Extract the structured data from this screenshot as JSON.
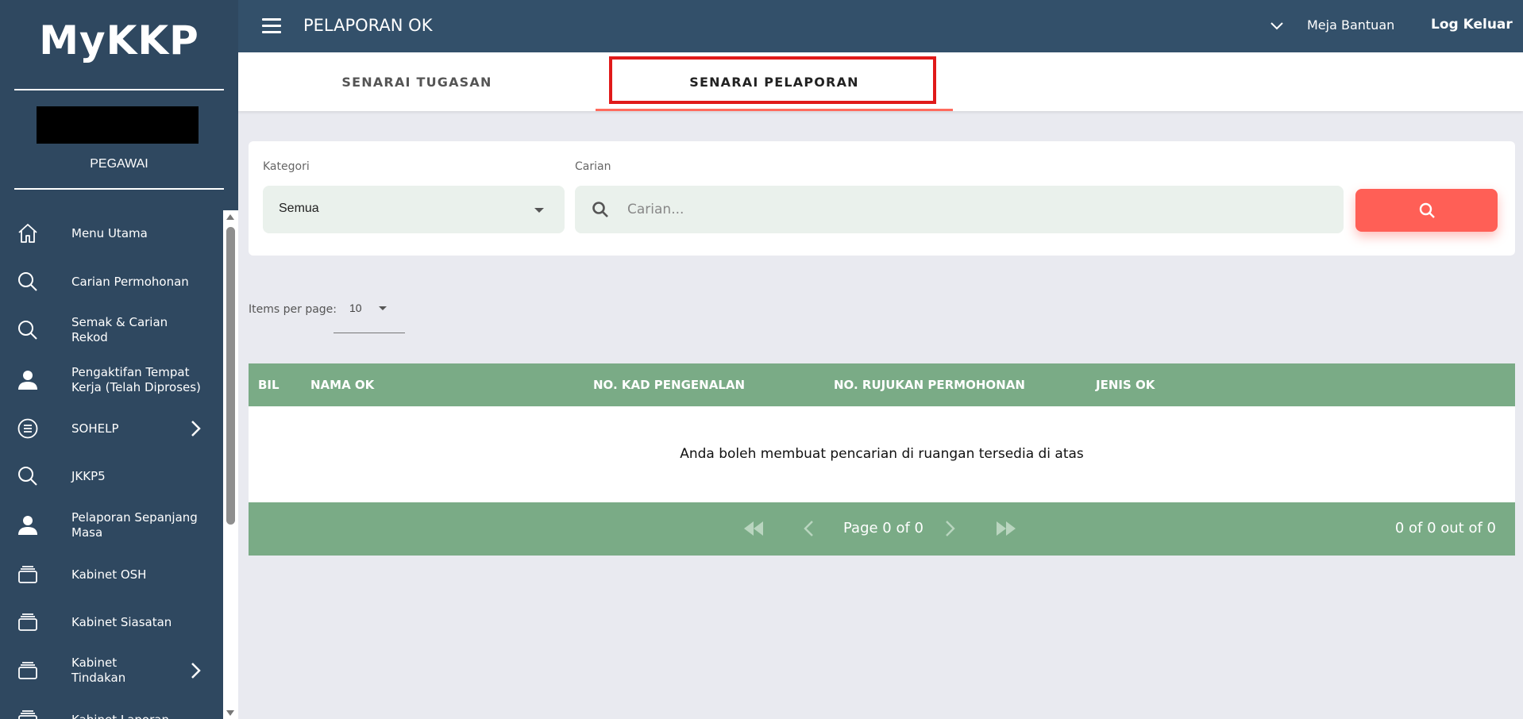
{
  "sidebar": {
    "logo": "MyKKP",
    "role": "PEGAWAI",
    "items": [
      {
        "label": "Menu Utama",
        "icon": "home-icon"
      },
      {
        "label": "Carian Permohonan",
        "icon": "search-icon"
      },
      {
        "label": "Semak & Carian Rekod",
        "icon": "search-icon"
      },
      {
        "label": "Pengaktifan Tempat Kerja (Telah Diproses)",
        "icon": "user-icon"
      },
      {
        "label": "SOHELP",
        "icon": "list-icon"
      },
      {
        "label": "JKKP5",
        "icon": "search-icon"
      },
      {
        "label": "Pelaporan Sepanjang Masa",
        "icon": "user-icon"
      },
      {
        "label": "Kabinet OSH",
        "icon": "cabinet-icon"
      },
      {
        "label": "Kabinet Siasatan",
        "icon": "cabinet-icon"
      },
      {
        "label": "Kabinet Tindakan",
        "icon": "cabinet-icon"
      },
      {
        "label": "Kabinet Laporan",
        "icon": "cabinet-icon"
      }
    ]
  },
  "topbar": {
    "title": "PELAPORAN OK",
    "help": "Meja Bantuan",
    "logout": "Log Keluar"
  },
  "tabs": [
    {
      "label": "SENARAI TUGASAN"
    },
    {
      "label": "SENARAI PELAPORAN"
    }
  ],
  "search": {
    "category_label": "Kategori",
    "category_value": "Semua",
    "search_label": "Carian",
    "search_placeholder": "Carian..."
  },
  "pagination": {
    "items_per_page_label": "Items per page:",
    "items_per_page_value": "10",
    "page_text": "Page 0 of 0",
    "count_text": "0 of 0 out of 0"
  },
  "table": {
    "columns": [
      "BIL",
      "NAMA OK",
      "NO. KAD PENGENALAN",
      "NO. RUJUKAN PERMOHONAN",
      "JENIS OK"
    ],
    "empty_message": "Anda boleh membuat pencarian di ruangan tersedia di atas"
  },
  "colors": {
    "sidebar_bg": "#2f4860",
    "topbar_bg": "#33506a",
    "accent": "#ff5f56",
    "table_green": "#7aab86",
    "highlight_red": "#e01a1a"
  }
}
